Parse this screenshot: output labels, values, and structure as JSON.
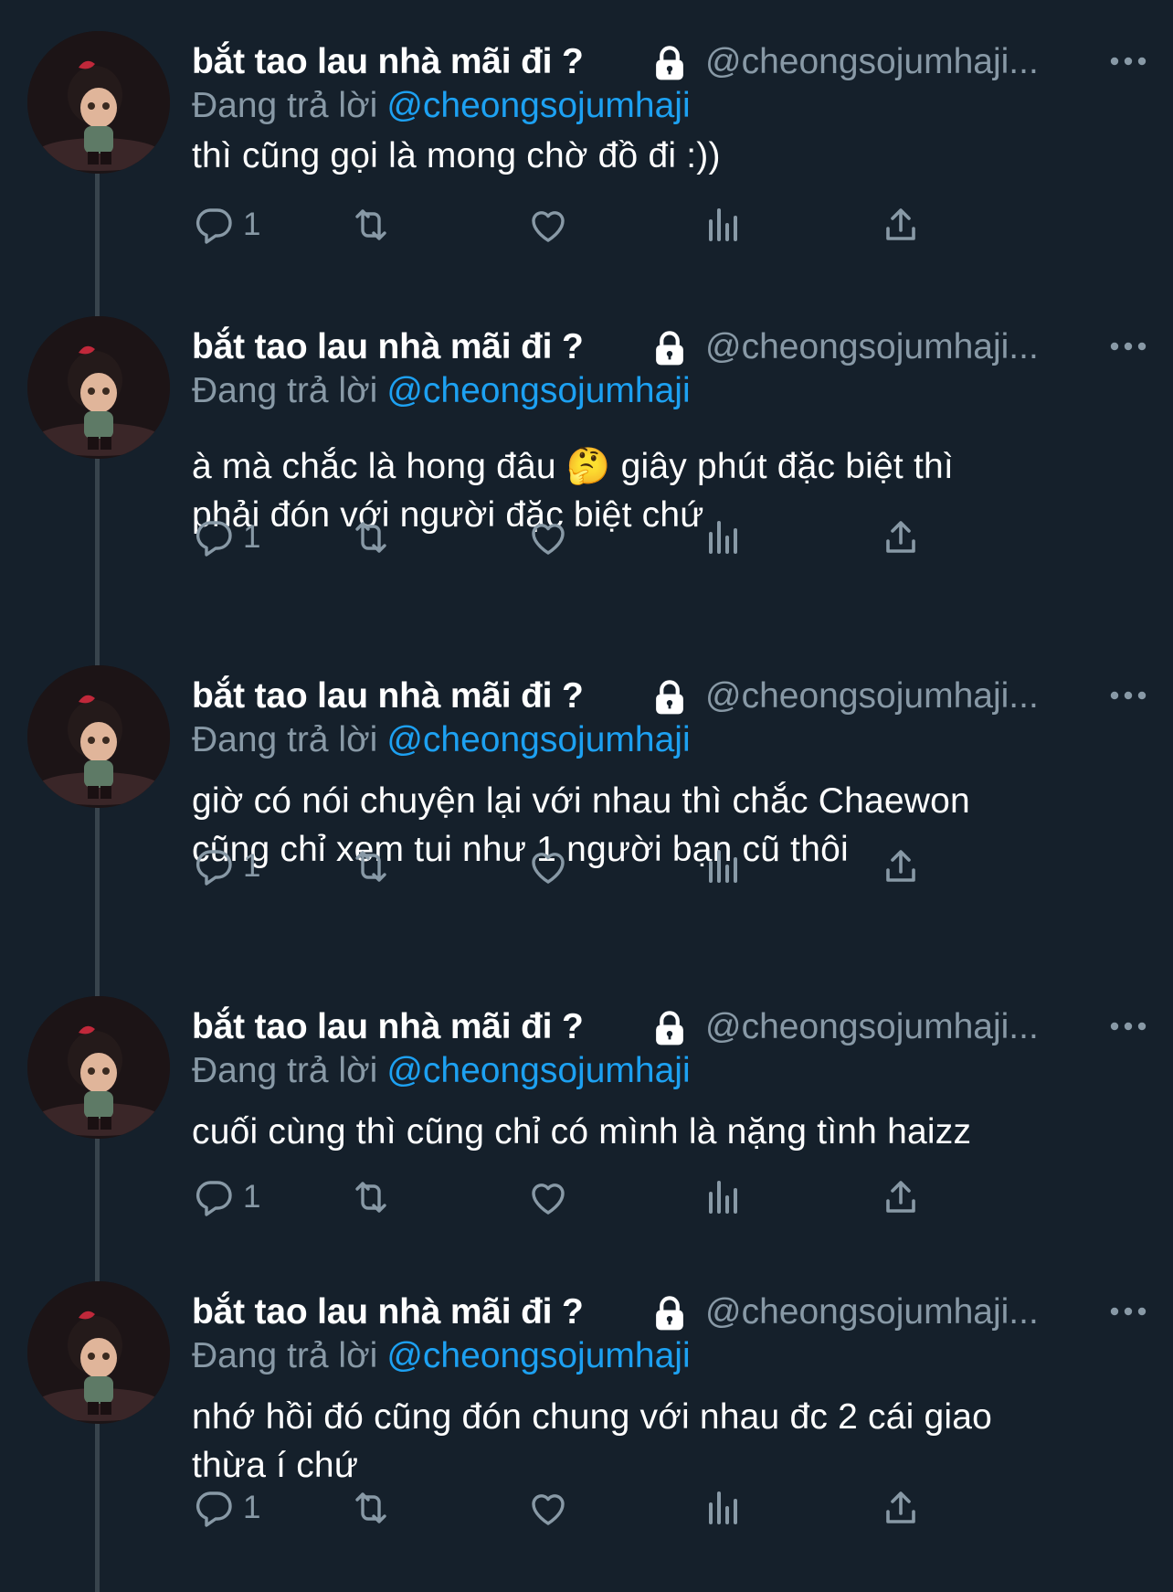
{
  "tweets": [
    {
      "name": "bắt tao lau nhà mãi đi ?",
      "handle": "@cheongsojumhaji...",
      "reply_prefix": "Đang trả lời",
      "reply_handle": "@cheongsojumhaji",
      "text_lines": [
        "thì cũng gọi là mong chờ đồ đi :))"
      ],
      "reply_count": "1"
    },
    {
      "name": "bắt tao lau nhà mãi đi ?",
      "handle": "@cheongsojumhaji...",
      "reply_prefix": "Đang trả lời",
      "reply_handle": "@cheongsojumhaji",
      "text_lines": [
        "à mà chắc là hong đâu 🤔  giây phút đặc biệt thì",
        "phải đón với người đặc biệt chứ"
      ],
      "reply_count": "1"
    },
    {
      "name": "bắt tao lau nhà mãi đi ?",
      "handle": "@cheongsojumhaji...",
      "reply_prefix": "Đang trả lời",
      "reply_handle": "@cheongsojumhaji",
      "text_lines": [
        "giờ có nói chuyện lại với nhau thì chắc Chaewon",
        "cũng chỉ xem tui như 1 người bạn cũ thôi"
      ],
      "reply_count": "1"
    },
    {
      "name": "bắt tao lau nhà mãi đi ?",
      "handle": "@cheongsojumhaji...",
      "reply_prefix": "Đang trả lời",
      "reply_handle": "@cheongsojumhaji",
      "text_lines": [
        "cuối cùng thì cũng chỉ có mình là nặng tình haizz"
      ],
      "reply_count": "1"
    },
    {
      "name": "bắt tao lau nhà mãi đi ?",
      "handle": "@cheongsojumhaji...",
      "reply_prefix": "Đang trả lời",
      "reply_handle": "@cheongsojumhaji",
      "text_lines": [
        "nhớ hồi đó cũng đón chung với nhau đc 2 cái giao",
        "thừa í chứ"
      ],
      "reply_count": "1"
    }
  ],
  "icons": {
    "protected": "lock-icon",
    "more": "more-icon",
    "reply": "reply-icon",
    "retweet": "retweet-icon",
    "like": "like-icon",
    "views": "views-icon",
    "share": "share-icon"
  },
  "colors": {
    "background": "#15202b",
    "secondary_text": "#8899a6",
    "link": "#1da1f2",
    "thread_line": "#38444d"
  }
}
